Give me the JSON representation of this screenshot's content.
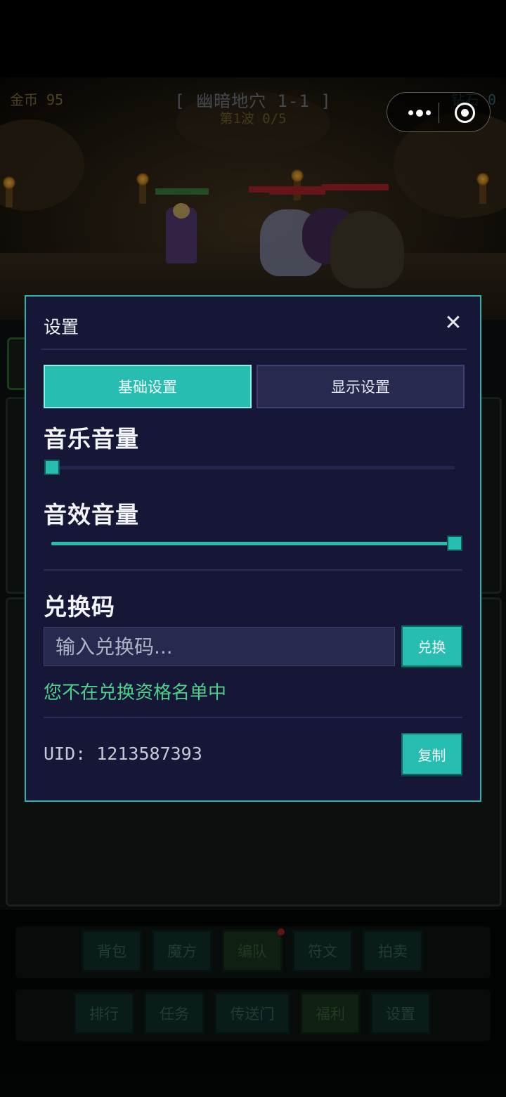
{
  "hud": {
    "gold": "金币 95",
    "stage": "[ 幽暗地穴 1-1 ]",
    "wave": "第1波 0/5",
    "diamond": "钻石 0"
  },
  "menu": {
    "row1": [
      "背包",
      "魔方",
      "编队",
      "符文",
      "拍卖"
    ],
    "row2": [
      "排行",
      "任务",
      "传送门",
      "福利",
      "设置"
    ]
  },
  "settings": {
    "title": "设置",
    "tabs": {
      "basic": "基础设置",
      "display": "显示设置"
    },
    "music_label": "音乐音量",
    "music_level": 0,
    "sfx_label": "音效音量",
    "sfx_level": 1,
    "redeem_label": "兑换码",
    "redeem_placeholder": "输入兑换码...",
    "redeem_button": "兑换",
    "redeem_status": "您不在兑换资格名单中",
    "uid": "UID: 1213587393",
    "copy_button": "复制"
  },
  "colors": {
    "accent": "#27bdb1",
    "modal_bg": "#161737",
    "status_ok": "#4fd08a"
  },
  "icons": [
    "more-icon",
    "target-icon",
    "close-icon"
  ]
}
